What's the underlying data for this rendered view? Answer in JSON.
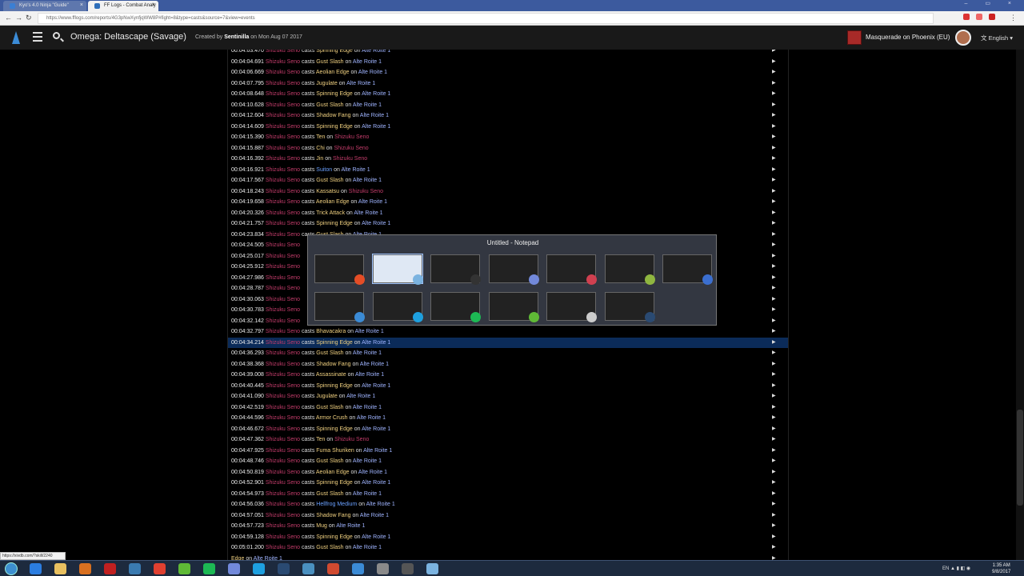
{
  "browser": {
    "tabs": [
      {
        "label": "Kyo's 4.0 Ninja \"Guide\"",
        "favicon_color": "#3b7fd4"
      },
      {
        "label": "FF Logs - Combat Analy",
        "favicon_color": "#2f6fba"
      }
    ],
    "url": "https://www.fflogs.com/reports/4G3pNwXynfjqWW8P#fight=8&type=casts&source=7&view=events",
    "status_url": "https://xivdb.com/?skill/2240",
    "ext_colors": [
      "#d33",
      "#e66",
      "#c22"
    ]
  },
  "app": {
    "title": "Omega: Deltascape (Savage)",
    "created_prefix": "Created by",
    "creator": "Sentinilla",
    "date_text": "on Mon Aug 07 2017",
    "character": "Masquerade on Phoenix (EU)",
    "language": "English",
    "icons": {
      "logo": "fflogs-logo-icon",
      "menu": "hamburger-menu-icon",
      "search": "search-icon"
    }
  },
  "events": [
    {
      "time": "00:04:03.470",
      "source": "Shizuku Seno",
      "verb": "casts",
      "ability": "Spinning Edge",
      "on": "on",
      "target": "Alte Roite 1",
      "target_type": "enemy"
    },
    {
      "time": "00:04:04.691",
      "source": "Shizuku Seno",
      "verb": "casts",
      "ability": "Gust Slash",
      "on": "on",
      "target": "Alte Roite 1",
      "target_type": "enemy"
    },
    {
      "time": "00:04:06.669",
      "source": "Shizuku Seno",
      "verb": "casts",
      "ability": "Aeolian Edge",
      "on": "on",
      "target": "Alte Roite 1",
      "target_type": "enemy"
    },
    {
      "time": "00:04:07.795",
      "source": "Shizuku Seno",
      "verb": "casts",
      "ability": "Jugulate",
      "on": "on",
      "target": "Alte Roite 1",
      "target_type": "enemy"
    },
    {
      "time": "00:04:08.648",
      "source": "Shizuku Seno",
      "verb": "casts",
      "ability": "Spinning Edge",
      "on": "on",
      "target": "Alte Roite 1",
      "target_type": "enemy"
    },
    {
      "time": "00:04:10.628",
      "source": "Shizuku Seno",
      "verb": "casts",
      "ability": "Gust Slash",
      "on": "on",
      "target": "Alte Roite 1",
      "target_type": "enemy"
    },
    {
      "time": "00:04:12.604",
      "source": "Shizuku Seno",
      "verb": "casts",
      "ability": "Shadow Fang",
      "on": "on",
      "target": "Alte Roite 1",
      "target_type": "enemy"
    },
    {
      "time": "00:04:14.609",
      "source": "Shizuku Seno",
      "verb": "casts",
      "ability": "Spinning Edge",
      "on": "on",
      "target": "Alte Roite 1",
      "target_type": "enemy"
    },
    {
      "time": "00:04:15.390",
      "source": "Shizuku Seno",
      "verb": "casts",
      "ability": "Ten",
      "on": "on",
      "target": "Shizuku Seno",
      "target_type": "self"
    },
    {
      "time": "00:04:15.887",
      "source": "Shizuku Seno",
      "verb": "casts",
      "ability": "Chi",
      "on": "on",
      "target": "Shizuku Seno",
      "target_type": "self"
    },
    {
      "time": "00:04:16.392",
      "source": "Shizuku Seno",
      "verb": "casts",
      "ability": "Jin",
      "on": "on",
      "target": "Shizuku Seno",
      "target_type": "self"
    },
    {
      "time": "00:04:16.921",
      "source": "Shizuku Seno",
      "verb": "casts",
      "ability": "Suiton",
      "on": "on",
      "target": "Alte Roite 1",
      "target_type": "enemy",
      "ability_type": "ninjutsu"
    },
    {
      "time": "00:04:17.567",
      "source": "Shizuku Seno",
      "verb": "casts",
      "ability": "Gust Slash",
      "on": "on",
      "target": "Alte Roite 1",
      "target_type": "enemy"
    },
    {
      "time": "00:04:18.243",
      "source": "Shizuku Seno",
      "verb": "casts",
      "ability": "Kassatsu",
      "on": "on",
      "target": "Shizuku Seno",
      "target_type": "self"
    },
    {
      "time": "00:04:19.658",
      "source": "Shizuku Seno",
      "verb": "casts",
      "ability": "Aeolian Edge",
      "on": "on",
      "target": "Alte Roite 1",
      "target_type": "enemy"
    },
    {
      "time": "00:04:20.326",
      "source": "Shizuku Seno",
      "verb": "casts",
      "ability": "Trick Attack",
      "on": "on",
      "target": "Alte Roite 1",
      "target_type": "enemy"
    },
    {
      "time": "00:04:21.757",
      "source": "Shizuku Seno",
      "verb": "casts",
      "ability": "Spinning Edge",
      "on": "on",
      "target": "Alte Roite 1",
      "target_type": "enemy"
    },
    {
      "time": "00:04:23.834",
      "source": "Shizuku Seno",
      "verb": "casts",
      "ability": "Gust Slash",
      "on": "on",
      "target": "Alte Roite 1",
      "target_type": "enemy"
    },
    {
      "time": "00:04:24.505",
      "source": "Shizuku Seno",
      "verb": "",
      "ability": "",
      "on": "",
      "target": "",
      "target_type": "enemy"
    },
    {
      "time": "00:04:25.017",
      "source": "Shizuku Seno",
      "verb": "",
      "ability": "",
      "on": "",
      "target": "",
      "target_type": "enemy"
    },
    {
      "time": "00:04:25.912",
      "source": "Shizuku Seno",
      "verb": "",
      "ability": "",
      "on": "",
      "target": "",
      "target_type": "enemy"
    },
    {
      "time": "00:04:27.986",
      "source": "Shizuku Seno",
      "verb": "",
      "ability": "",
      "on": "",
      "target": "",
      "target_type": "enemy"
    },
    {
      "time": "00:04:28.787",
      "source": "Shizuku Seno",
      "verb": "",
      "ability": "",
      "on": "",
      "target": "",
      "target_type": "enemy"
    },
    {
      "time": "00:04:30.063",
      "source": "Shizuku Seno",
      "verb": "",
      "ability": "",
      "on": "",
      "target": "",
      "target_type": "enemy"
    },
    {
      "time": "00:04:30.783",
      "source": "Shizuku Seno",
      "verb": "",
      "ability": "",
      "on": "",
      "target": "",
      "target_type": "enemy"
    },
    {
      "time": "00:04:32.142",
      "source": "Shizuku Seno",
      "verb": "",
      "ability": "",
      "on": "",
      "target": "",
      "target_type": "enemy"
    },
    {
      "time": "00:04:32.797",
      "source": "Shizuku Seno",
      "verb": "casts",
      "ability": "Bhavacakra",
      "on": "on",
      "target": "Alte Roite 1",
      "target_type": "enemy"
    },
    {
      "time": "00:04:34.214",
      "source": "Shizuku Seno",
      "verb": "casts",
      "ability": "Spinning Edge",
      "on": "on",
      "target": "Alte Roite 1",
      "target_type": "enemy",
      "selected": true
    },
    {
      "time": "00:04:36.293",
      "source": "Shizuku Seno",
      "verb": "casts",
      "ability": "Gust Slash",
      "on": "on",
      "target": "Alte Roite 1",
      "target_type": "enemy"
    },
    {
      "time": "00:04:38.368",
      "source": "Shizuku Seno",
      "verb": "casts",
      "ability": "Shadow Fang",
      "on": "on",
      "target": "Alte Roite 1",
      "target_type": "enemy"
    },
    {
      "time": "00:04:39.008",
      "source": "Shizuku Seno",
      "verb": "casts",
      "ability": "Assassinate",
      "on": "on",
      "target": "Alte Roite 1",
      "target_type": "enemy"
    },
    {
      "time": "00:04:40.445",
      "source": "Shizuku Seno",
      "verb": "casts",
      "ability": "Spinning Edge",
      "on": "on",
      "target": "Alte Roite 1",
      "target_type": "enemy"
    },
    {
      "time": "00:04:41.090",
      "source": "Shizuku Seno",
      "verb": "casts",
      "ability": "Jugulate",
      "on": "on",
      "target": "Alte Roite 1",
      "target_type": "enemy"
    },
    {
      "time": "00:04:42.519",
      "source": "Shizuku Seno",
      "verb": "casts",
      "ability": "Gust Slash",
      "on": "on",
      "target": "Alte Roite 1",
      "target_type": "enemy"
    },
    {
      "time": "00:04:44.596",
      "source": "Shizuku Seno",
      "verb": "casts",
      "ability": "Armor Crush",
      "on": "on",
      "target": "Alte Roite 1",
      "target_type": "enemy"
    },
    {
      "time": "00:04:46.672",
      "source": "Shizuku Seno",
      "verb": "casts",
      "ability": "Spinning Edge",
      "on": "on",
      "target": "Alte Roite 1",
      "target_type": "enemy"
    },
    {
      "time": "00:04:47.362",
      "source": "Shizuku Seno",
      "verb": "casts",
      "ability": "Ten",
      "on": "on",
      "target": "Shizuku Seno",
      "target_type": "self"
    },
    {
      "time": "00:04:47.925",
      "source": "Shizuku Seno",
      "verb": "casts",
      "ability": "Fuma Shuriken",
      "on": "on",
      "target": "Alte Roite 1",
      "target_type": "enemy"
    },
    {
      "time": "00:04:48.746",
      "source": "Shizuku Seno",
      "verb": "casts",
      "ability": "Gust Slash",
      "on": "on",
      "target": "Alte Roite 1",
      "target_type": "enemy"
    },
    {
      "time": "00:04:50.819",
      "source": "Shizuku Seno",
      "verb": "casts",
      "ability": "Aeolian Edge",
      "on": "on",
      "target": "Alte Roite 1",
      "target_type": "enemy"
    },
    {
      "time": "00:04:52.901",
      "source": "Shizuku Seno",
      "verb": "casts",
      "ability": "Spinning Edge",
      "on": "on",
      "target": "Alte Roite 1",
      "target_type": "enemy"
    },
    {
      "time": "00:04:54.973",
      "source": "Shizuku Seno",
      "verb": "casts",
      "ability": "Gust Slash",
      "on": "on",
      "target": "Alte Roite 1",
      "target_type": "enemy"
    },
    {
      "time": "00:04:56.036",
      "source": "Shizuku Seno",
      "verb": "casts",
      "ability": "Hellfrog Medium",
      "on": "on",
      "target": "Alte Roite 1",
      "target_type": "enemy",
      "ability_type": "ninjutsu"
    },
    {
      "time": "00:04:57.051",
      "source": "Shizuku Seno",
      "verb": "casts",
      "ability": "Shadow Fang",
      "on": "on",
      "target": "Alte Roite 1",
      "target_type": "enemy"
    },
    {
      "time": "00:04:57.723",
      "source": "Shizuku Seno",
      "verb": "casts",
      "ability": "Mug",
      "on": "on",
      "target": "Alte Roite 1",
      "target_type": "enemy"
    },
    {
      "time": "00:04:59.128",
      "source": "Shizuku Seno",
      "verb": "casts",
      "ability": "Spinning Edge",
      "on": "on",
      "target": "Alte Roite 1",
      "target_type": "enemy"
    },
    {
      "time": "00:05:01.200",
      "source": "Shizuku Seno",
      "verb": "casts",
      "ability": "Gust Slash",
      "on": "on",
      "target": "Alte Roite 1",
      "target_type": "enemy"
    },
    {
      "time": "",
      "source": "",
      "verb": "",
      "ability": "Edge",
      "on": "on",
      "target": "Alte Roite 1",
      "target_type": "enemy"
    }
  ],
  "alt_tab": {
    "caption": "Untitled - Notepad",
    "windows": [
      {
        "app": "chrome",
        "badge_color": "#e44d26"
      },
      {
        "app": "notepad",
        "badge_color": "#7bb3e0",
        "selected": true
      },
      {
        "app": "obs",
        "badge_color": "#333333"
      },
      {
        "app": "discord",
        "badge_color": "#7289da"
      },
      {
        "app": "game-launcher",
        "badge_color": "#d04050"
      },
      {
        "app": "editor",
        "badge_color": "#8fb640"
      },
      {
        "app": "game",
        "badge_color": "#3b6fd0"
      },
      {
        "app": "game-launcher-2",
        "badge_color": "#3b8bd6"
      },
      {
        "app": "skype",
        "badge_color": "#1ea0e0"
      },
      {
        "app": "spotify",
        "badge_color": "#1db954"
      },
      {
        "app": "utorrent",
        "badge_color": "#5fb936"
      },
      {
        "app": "explorer",
        "badge_color": "#cccccc"
      },
      {
        "app": "steam",
        "badge_color": "#2a4a72"
      }
    ]
  },
  "taskbar": {
    "icons": [
      {
        "name": "ie-icon",
        "color": "#2b7de0"
      },
      {
        "name": "folder-icon",
        "color": "#e8c060"
      },
      {
        "name": "media-player-icon",
        "color": "#d87020"
      },
      {
        "name": "launcher-icon",
        "color": "#c02020"
      },
      {
        "name": "settings-icon",
        "color": "#3a7ab0"
      },
      {
        "name": "chrome-icon",
        "color": "#e04030"
      },
      {
        "name": "utorrent-icon",
        "color": "#5fb936"
      },
      {
        "name": "spotify-icon",
        "color": "#1db954"
      },
      {
        "name": "discord-icon",
        "color": "#7289da"
      },
      {
        "name": "skype-icon",
        "color": "#1ea0e0"
      },
      {
        "name": "steam-icon",
        "color": "#2a4a72"
      },
      {
        "name": "network-icon",
        "color": "#4a90c0"
      },
      {
        "name": "origin-icon",
        "color": "#d04a30"
      },
      {
        "name": "fflogs-icon",
        "color": "#3b8bd6"
      },
      {
        "name": "game-icon",
        "color": "#8a8a8a"
      },
      {
        "name": "obs-icon",
        "color": "#555555"
      },
      {
        "name": "notepad-icon",
        "color": "#7bb3e0"
      }
    ],
    "tray_lang": "EN",
    "time": "1:35 AM",
    "date": "9/8/2017"
  }
}
